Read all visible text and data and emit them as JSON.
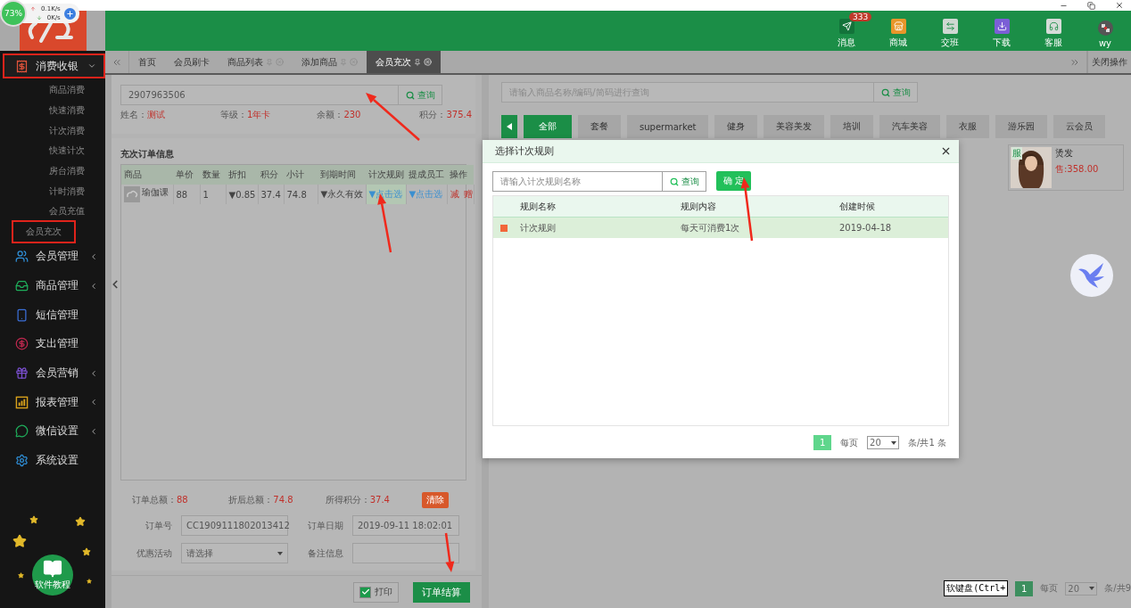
{
  "overlay_widget": {
    "percent": "73%",
    "upload": "0.1K/s",
    "download": "0K/s"
  },
  "sidebar": {
    "groups": [
      {
        "label": "消费收银",
        "kind": "menu",
        "expanded": true,
        "highlighted": true,
        "children": [
          {
            "label": "商品消费",
            "highlighted": false
          },
          {
            "label": "快速消费",
            "highlighted": false
          },
          {
            "label": "计次消费",
            "highlighted": false
          },
          {
            "label": "快速计次",
            "highlighted": false
          },
          {
            "label": "房台消费",
            "highlighted": false
          },
          {
            "label": "计时消费",
            "highlighted": false
          },
          {
            "label": "会员充值",
            "highlighted": false
          },
          {
            "label": "会员充次",
            "highlighted": true
          }
        ]
      },
      {
        "label": "会员管理",
        "kind": "menu",
        "expanded": false,
        "highlighted": false
      },
      {
        "label": "商品管理",
        "kind": "menu",
        "expanded": false,
        "highlighted": false
      },
      {
        "label": "短信管理",
        "kind": "link",
        "highlighted": false
      },
      {
        "label": "支出管理",
        "kind": "link",
        "highlighted": false
      },
      {
        "label": "会员营销",
        "kind": "menu",
        "expanded": false,
        "highlighted": false
      },
      {
        "label": "报表管理",
        "kind": "menu",
        "expanded": false,
        "highlighted": false
      },
      {
        "label": "微信设置",
        "kind": "menu",
        "expanded": false,
        "highlighted": false
      },
      {
        "label": "系统设置",
        "kind": "link",
        "highlighted": false
      }
    ],
    "tutorial": "软件教程"
  },
  "header": {
    "actions": [
      {
        "label": "消息",
        "badge": "333"
      },
      {
        "label": "商城"
      },
      {
        "label": "交班"
      },
      {
        "label": "下载"
      },
      {
        "label": "客服"
      },
      {
        "label": "wy"
      }
    ]
  },
  "tabs": [
    {
      "label": "首页",
      "selected": false,
      "closable": false
    },
    {
      "label": "会员刷卡",
      "selected": false,
      "closable": false
    },
    {
      "label": "商品列表",
      "selected": false,
      "closable": true
    },
    {
      "label": "添加商品",
      "selected": false,
      "closable": true
    },
    {
      "label": "会员充次",
      "selected": true,
      "closable": true
    }
  ],
  "tab_close_all": "关闭操作",
  "member": {
    "search_value": "2907963506",
    "search_button": "查询",
    "info": [
      {
        "label": "姓名：",
        "value": "测试"
      },
      {
        "label": "等级：",
        "value": "1年卡"
      },
      {
        "label": "余额：",
        "value": "230"
      },
      {
        "label": "积分：",
        "value": "375.4"
      }
    ]
  },
  "order": {
    "title": "充次订单信息",
    "columns": [
      "商品",
      "单价",
      "数量",
      "折扣",
      "积分",
      "小计",
      "到期时间",
      "计次规则",
      "提成员工",
      "操作"
    ],
    "rows": [
      {
        "product": "瑜伽课",
        "price": "88",
        "qty": "1",
        "discount": "▼0.85",
        "points": "37.4",
        "subtotal": "74.8",
        "expiry": "▼永久有效",
        "rule": "▼点击选",
        "staff": "▼点击选",
        "actions": [
          "减",
          "赠"
        ]
      }
    ],
    "summary": [
      {
        "label": "订单总额：",
        "value": "88"
      },
      {
        "label": "折后总额：",
        "value": "74.8"
      },
      {
        "label": "所得积分：",
        "value": "37.4"
      }
    ],
    "clear_button": "清除",
    "order_no": {
      "label": "订单号",
      "value": "CC1909111802013412"
    },
    "order_date": {
      "label": "订单日期",
      "value": "2019-09-11 18:02:01"
    },
    "promotion": {
      "label": "优惠活动",
      "value": "请选择"
    },
    "note": {
      "label": "备注信息"
    },
    "print": {
      "label": "打印",
      "checked": true
    },
    "submit": "订单结算"
  },
  "products": {
    "search_placeholder": "请输入商品名称/编码/简码进行查询",
    "search_button": "查询",
    "categories": [
      {
        "label": "全部",
        "selected": true
      },
      {
        "label": "套餐",
        "selected": false
      },
      {
        "label": "supermarket",
        "selected": false
      },
      {
        "label": "健身",
        "selected": false
      },
      {
        "label": "美容美发",
        "selected": false
      },
      {
        "label": "培训",
        "selected": false
      },
      {
        "label": "汽车美容",
        "selected": false
      },
      {
        "label": "衣服",
        "selected": false
      },
      {
        "label": "游乐园",
        "selected": false
      },
      {
        "label": "云会员",
        "selected": false
      }
    ],
    "items": [
      {
        "tag": "服",
        "name": "烫发",
        "price": "售:358.00",
        "kind": "picture"
      }
    ],
    "soft_keyboard": "软键盘(Ctrl+",
    "pagination": {
      "page": "1",
      "per_page_label": "每页",
      "per_page": "20",
      "total": "条/共9"
    }
  },
  "dialog": {
    "title": "选择计次规则",
    "search_placeholder": "请输入计次规则名称",
    "search_button": "查询",
    "confirm_button": "确 定",
    "columns": [
      "规则名称",
      "规则内容",
      "创建时候"
    ],
    "rows": [
      {
        "checked": true,
        "selected": true,
        "name": "计次规则",
        "content": "每天可消费1次",
        "created": "2019-04-18"
      }
    ],
    "pagination": {
      "page": "1",
      "per_page_label": "每页",
      "per_page": "20",
      "total": "条/共1 条"
    }
  }
}
